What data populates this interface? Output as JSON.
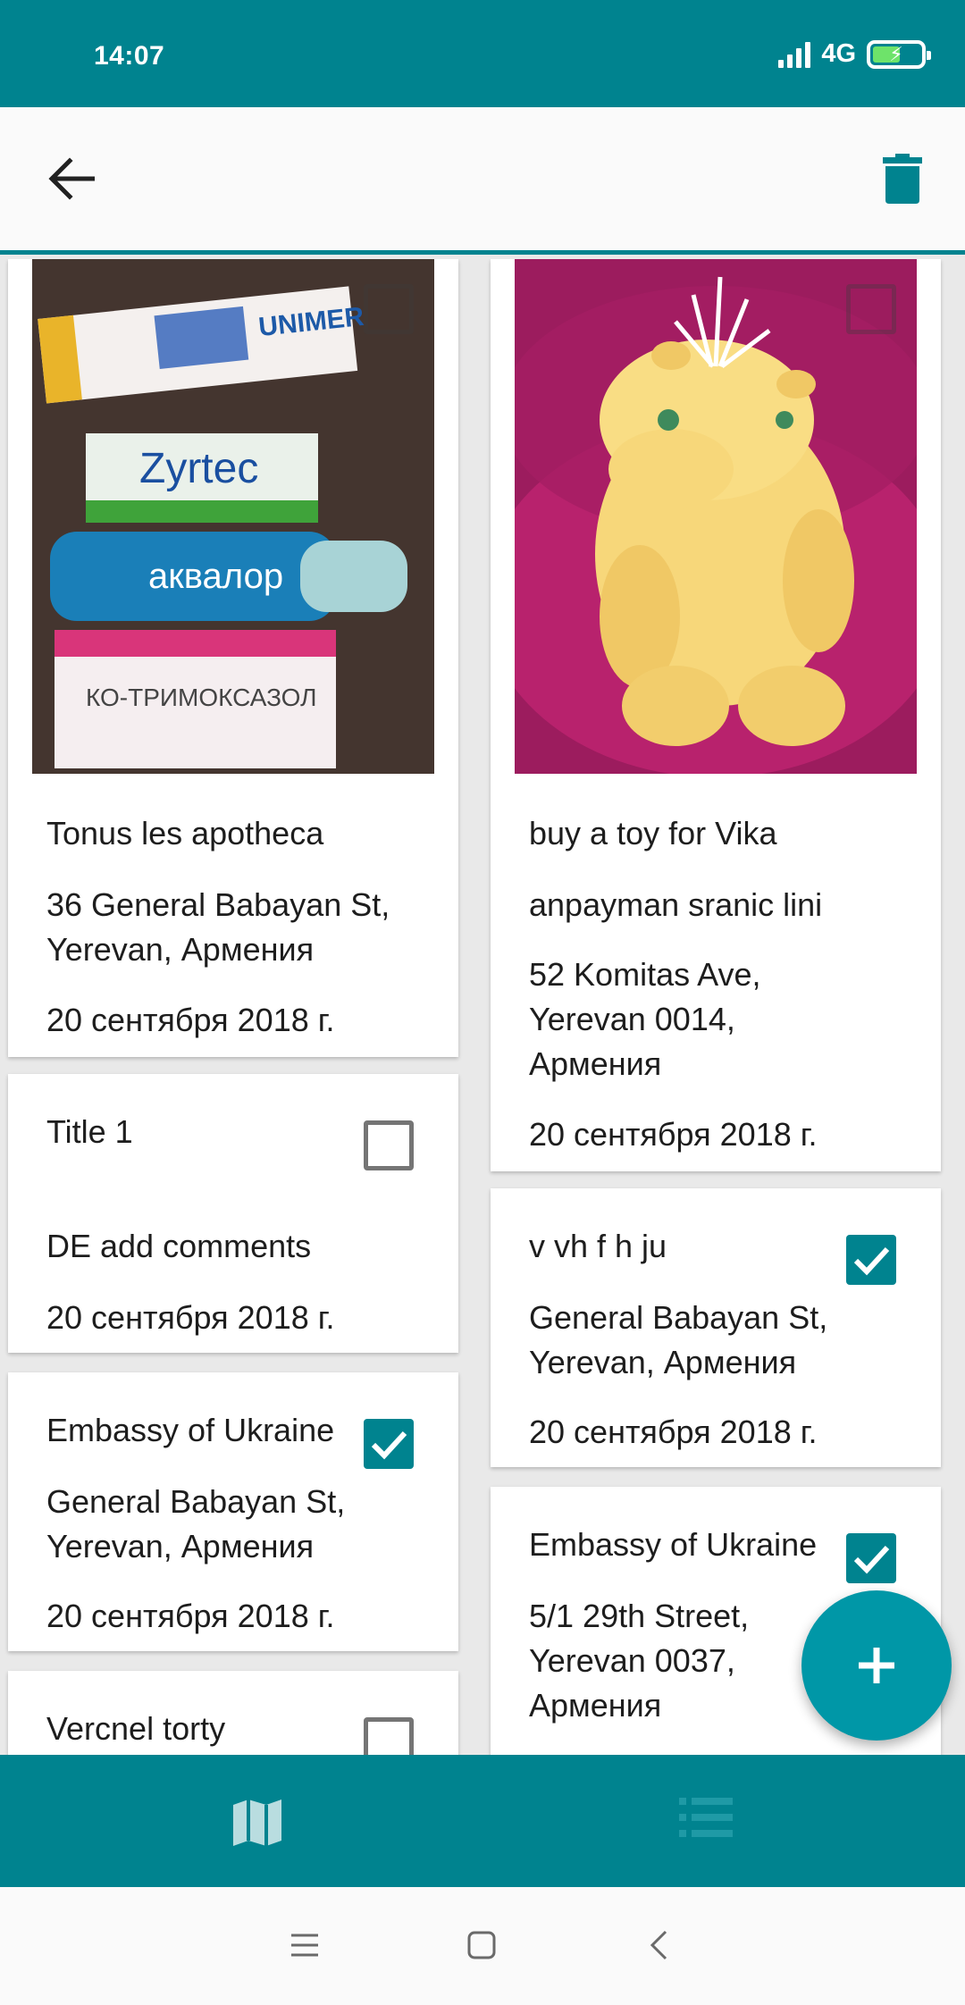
{
  "status_bar": {
    "time": "14:07",
    "network": "4G",
    "network_sub": "ıl",
    "battery_state": "charging"
  },
  "toolbar": {
    "back_icon": "arrow-left-icon",
    "delete_icon": "trash-icon"
  },
  "colors": {
    "primary": "#00838f",
    "accent": "#0097a7",
    "card_bg": "#ffffff",
    "text": "#1d1d1d"
  },
  "left_column": [
    {
      "title": "Tonus les apotheca",
      "address": "36 General Babayan St, Yerevan, Армения",
      "date": "20 сентября 2018 г.",
      "image": "medicine-boxes-photo",
      "checked": false
    },
    {
      "title": "Title 1",
      "comment": "DE add comments",
      "date": "20 сентября 2018 г.",
      "checked": false
    },
    {
      "title": "Embassy of Ukraine",
      "address": "General Babayan St, Yerevan, Армения",
      "date": "20 сентября 2018 г.",
      "checked": true
    },
    {
      "title": "Vercnel torty",
      "checked": false
    }
  ],
  "right_column": [
    {
      "title": "buy a toy for Vika",
      "comment": "anpayman sranic lini",
      "address": "52 Komitas Ave, Yerevan 0014, Армения",
      "date": "20 сентября 2018 г.",
      "image": "plush-toy-photo",
      "checked": false
    },
    {
      "title": "v vh f h ju",
      "address": "General Babayan St, Yerevan, Армения",
      "date": "20 сентября 2018 г.",
      "checked": true
    },
    {
      "title": "Embassy of Ukraine",
      "address": "5/1 29th Street, Yerevan 0037, Армения",
      "checked": true
    }
  ],
  "fab": {
    "icon": "plus-icon"
  },
  "bottom_nav": {
    "items": [
      {
        "icon": "map-icon",
        "active": true
      },
      {
        "icon": "list-icon",
        "active": false
      }
    ]
  },
  "system_nav": {
    "items": [
      "menu-icon",
      "home-icon",
      "back-icon"
    ]
  }
}
